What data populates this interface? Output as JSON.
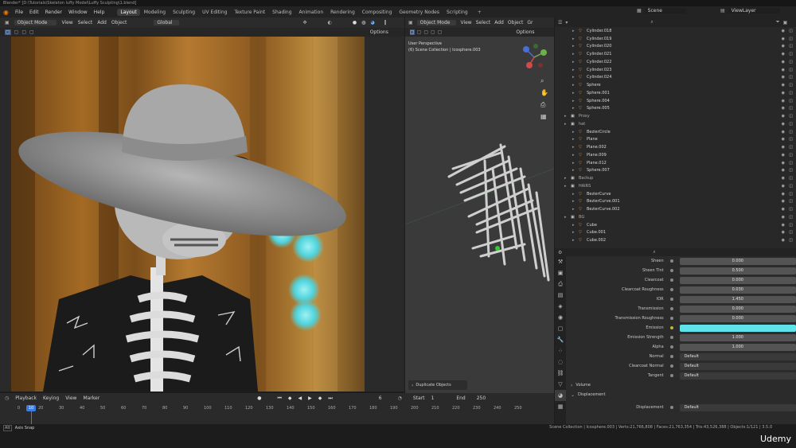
{
  "window_title": "Blender* [D:\\Tutorials\\Skeleton luffy Model\\Luffy Sculpting\\1.blend]",
  "menu": [
    "File",
    "Edit",
    "Render",
    "Window",
    "Help"
  ],
  "workspaces": [
    "Layout",
    "Modeling",
    "Sculpting",
    "UV Editing",
    "Texture Paint",
    "Shading",
    "Animation",
    "Rendering",
    "Compositing",
    "Geometry Nodes",
    "Scripting"
  ],
  "active_workspace": "Layout",
  "scene_label": "Scene",
  "viewlayer_label": "ViewLayer",
  "left_viewport": {
    "mode": "Object Mode",
    "menu": [
      "View",
      "Select",
      "Add",
      "Object"
    ],
    "transform": "Global",
    "options": "Options"
  },
  "right_viewport": {
    "mode": "Object Mode",
    "menu": [
      "View",
      "Select",
      "Add",
      "Object",
      "Gr"
    ],
    "options": "Options",
    "perspective": "User Perspective",
    "collection": "(6) Scene Collection | Icosphere.003",
    "operator_panel": "Duplicate Objects"
  },
  "outliner": {
    "rows": [
      {
        "name": "Cylinder.018",
        "type": "obj",
        "indent": 2
      },
      {
        "name": "Cylinder.019",
        "type": "obj",
        "indent": 2
      },
      {
        "name": "Cylinder.020",
        "type": "obj",
        "indent": 2
      },
      {
        "name": "Cylinder.021",
        "type": "obj",
        "indent": 2
      },
      {
        "name": "Cylinder.022",
        "type": "obj",
        "indent": 2
      },
      {
        "name": "Cylinder.023",
        "type": "obj",
        "indent": 2
      },
      {
        "name": "Cylinder.024",
        "type": "obj",
        "indent": 2
      },
      {
        "name": "Sphere",
        "type": "obj",
        "indent": 2
      },
      {
        "name": "Sphere.001",
        "type": "obj",
        "indent": 2
      },
      {
        "name": "Sphere.004",
        "type": "obj",
        "indent": 2
      },
      {
        "name": "Sphere.005",
        "type": "obj",
        "indent": 2
      },
      {
        "name": "Proxy",
        "type": "col",
        "indent": 1
      },
      {
        "name": "hat",
        "type": "col",
        "indent": 1
      },
      {
        "name": "BezierCircle",
        "type": "obj",
        "indent": 2
      },
      {
        "name": "Plane",
        "type": "obj",
        "indent": 2
      },
      {
        "name": "Plane.002",
        "type": "obj",
        "indent": 2
      },
      {
        "name": "Plane.009",
        "type": "obj",
        "indent": 2
      },
      {
        "name": "Plane.012",
        "type": "obj",
        "indent": 2
      },
      {
        "name": "Sphere.007",
        "type": "obj",
        "indent": 2
      },
      {
        "name": "Backup",
        "type": "col",
        "indent": 1
      },
      {
        "name": "HAIRS",
        "type": "col",
        "indent": 1
      },
      {
        "name": "BezierCurve",
        "type": "obj",
        "indent": 2
      },
      {
        "name": "BezierCurve.001",
        "type": "obj",
        "indent": 2
      },
      {
        "name": "BezierCurve.002",
        "type": "obj",
        "indent": 2
      },
      {
        "name": "BG",
        "type": "col",
        "indent": 1
      },
      {
        "name": "Cube",
        "type": "obj",
        "indent": 2
      },
      {
        "name": "Cube.001",
        "type": "obj",
        "indent": 2
      },
      {
        "name": "Cube.002",
        "type": "obj",
        "indent": 2
      }
    ]
  },
  "properties": {
    "rows": [
      {
        "label": "Sheen",
        "value": "0.000"
      },
      {
        "label": "Sheen Tint",
        "value": "0.500"
      },
      {
        "label": "Clearcoat",
        "value": "0.000"
      },
      {
        "label": "Clearcoat Roughness",
        "value": "0.030"
      },
      {
        "label": "IOR",
        "value": "1.450"
      },
      {
        "label": "Transmission",
        "value": "0.000"
      },
      {
        "label": "Transmission Roughness",
        "value": "0.000"
      },
      {
        "label": "Emission",
        "value": "",
        "color": "#5fe2ea"
      },
      {
        "label": "Emission Strength",
        "value": "1.000"
      },
      {
        "label": "Alpha",
        "value": "1.000"
      },
      {
        "label": "Normal",
        "value": "Default",
        "dark": true
      },
      {
        "label": "Clearcoat Normal",
        "value": "Default",
        "dark": true
      },
      {
        "label": "Tangent",
        "value": "Default",
        "dark": true
      }
    ],
    "volume_label": "Volume",
    "displacement_label": "Displacement",
    "displacement_row": {
      "label": "Displacement",
      "value": "Default"
    }
  },
  "timeline": {
    "menu": [
      "Playback",
      "Keying",
      "View",
      "Marker"
    ],
    "current_frame": "6",
    "start_label": "Start",
    "start": "1",
    "end_label": "End",
    "end": "250",
    "current_marker": "10",
    "ticks": [
      "0",
      "20",
      "30",
      "40",
      "50",
      "60",
      "70",
      "80",
      "90",
      "100",
      "110",
      "120",
      "130",
      "140",
      "150",
      "160",
      "170",
      "180",
      "190",
      "200",
      "210",
      "220",
      "230",
      "240",
      "250"
    ]
  },
  "status": {
    "left": "Axis Snap",
    "right": "Scene Collection | Icosphere.003 | Verts:21,766,808 | Faces:21,763,354 | Tris:43,526,388 | Objects:1/121 | 3.5.0"
  },
  "watermark": "Udemy"
}
